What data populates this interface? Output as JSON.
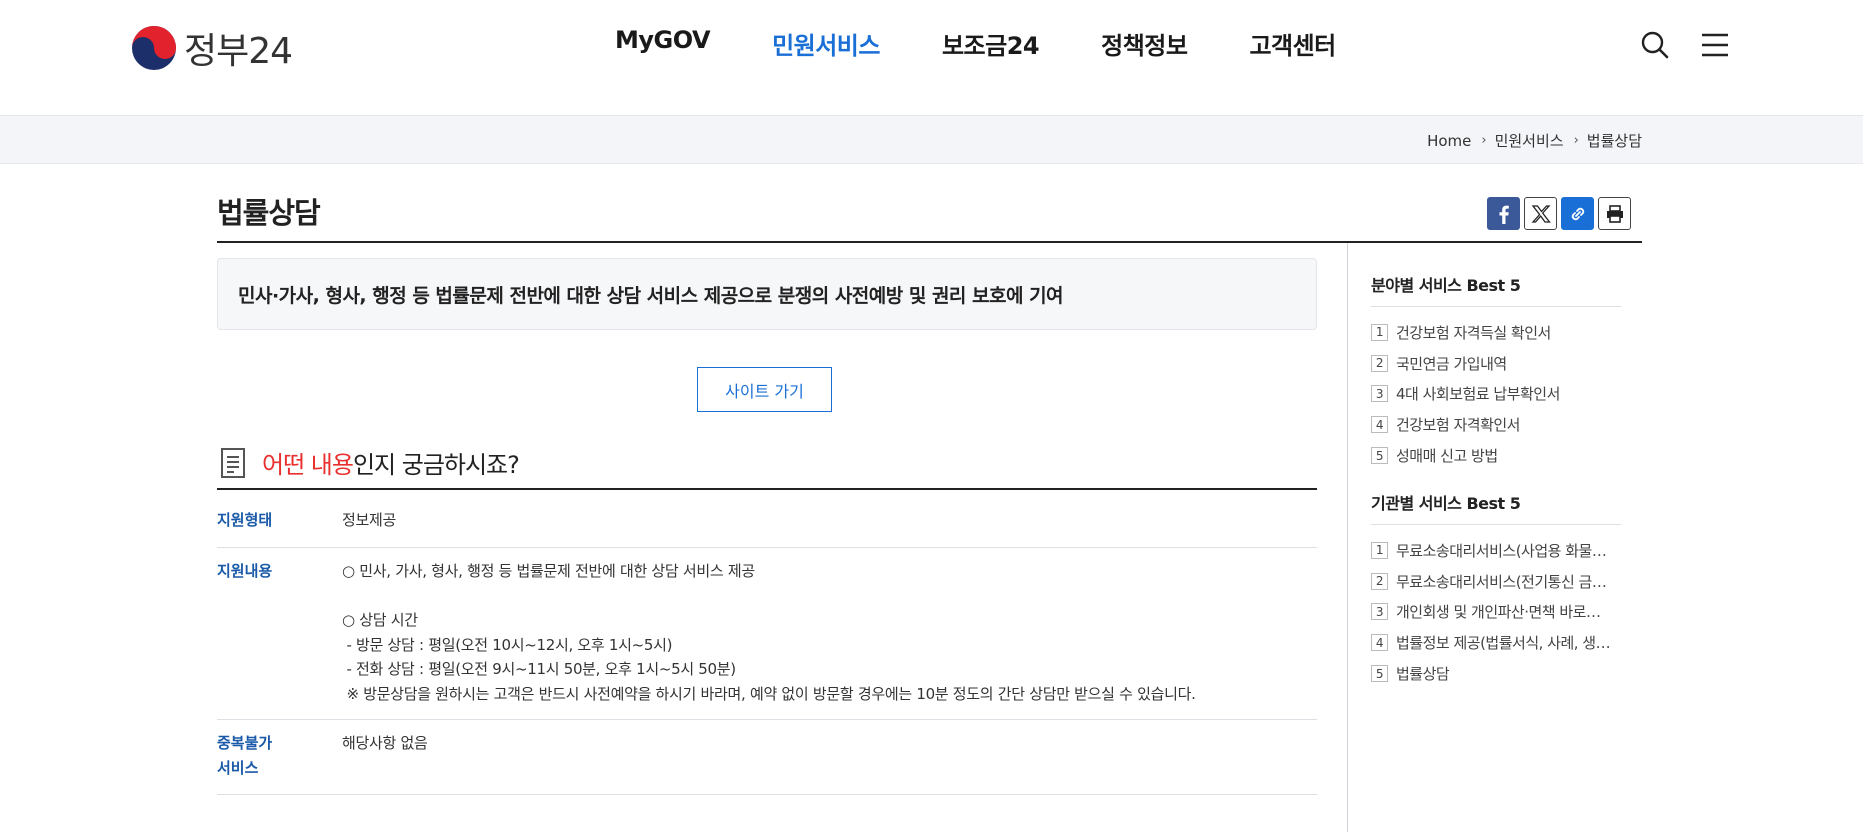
{
  "header": {
    "logo_text": "정부24",
    "nav": [
      {
        "label": "MyGOV"
      },
      {
        "label": "민원서비스"
      },
      {
        "label": "보조금24"
      },
      {
        "label": "정책정보"
      },
      {
        "label": "고객센터"
      }
    ],
    "active_nav_index": 1,
    "icons": [
      "search-icon",
      "menu-icon"
    ]
  },
  "breadcrumb": [
    "Home",
    "민원서비스",
    "법률상담"
  ],
  "page": {
    "title": "법률상담",
    "share_buttons": [
      "facebook-icon",
      "x-twitter-icon",
      "link-icon",
      "print-icon"
    ],
    "summary": "민사·가사, 형사, 행정 등 법률문제 전반에 대한 상담 서비스 제공으로 분쟁의 사전예방 및 권리 보호에 기여",
    "site_button": "사이트 가기",
    "question_heading": {
      "highlight": "어떤 내용",
      "rest": "인지 궁금하시죠?"
    },
    "rows": [
      {
        "label": "지원형태",
        "lines": [
          "정보제공"
        ]
      },
      {
        "label": "지원내용",
        "lines": [
          "○ 민사, 가사, 형사, 행정 등 법률문제 전반에 대한 상담 서비스 제공",
          "",
          "○ 상담 시간",
          " - 방문 상담 : 평일(오전 10시~12시, 오후 1시~5시)",
          " - 전화 상담 : 평일(오전 9시~11시 50분, 오후 1시~5시 50분)",
          " ※ 방문상담을 원하시는 고객은 반드시 사전예약을 하시기 바라며, 예약 없이 방문할 경우에는 10분 정도의 간단 상담만 받으실 수 있습니다."
        ]
      },
      {
        "label_lines": [
          "중복불가",
          "서비스"
        ],
        "lines": [
          "해당사항 없음"
        ]
      }
    ]
  },
  "sidebar": {
    "field_best": {
      "title": "분야별 서비스 Best 5",
      "items": [
        {
          "num": "1",
          "label": "건강보험 자격득실 확인서"
        },
        {
          "num": "2",
          "label": "국민연금 가입내역"
        },
        {
          "num": "3",
          "label": "4대 사회보험료 납부확인서"
        },
        {
          "num": "4",
          "label": "건강보험 자격확인서"
        },
        {
          "num": "5",
          "label": "성매매 신고 방법"
        }
      ]
    },
    "agency_best": {
      "title": "기관별 서비스 Best 5",
      "items": [
        {
          "num": "1",
          "label": "무료소송대리서비스(사업용 화물…"
        },
        {
          "num": "2",
          "label": "무료소송대리서비스(전기통신 금…"
        },
        {
          "num": "3",
          "label": "개인회생 및 개인파산·면책 바로…"
        },
        {
          "num": "4",
          "label": "법률정보 제공(법률서식, 사례, 생…"
        },
        {
          "num": "5",
          "label": "법률상담"
        }
      ]
    }
  },
  "colors": {
    "accent": "#1a6fd6",
    "highlight": "#e8312f",
    "label_blue": "#1a5aa8"
  }
}
